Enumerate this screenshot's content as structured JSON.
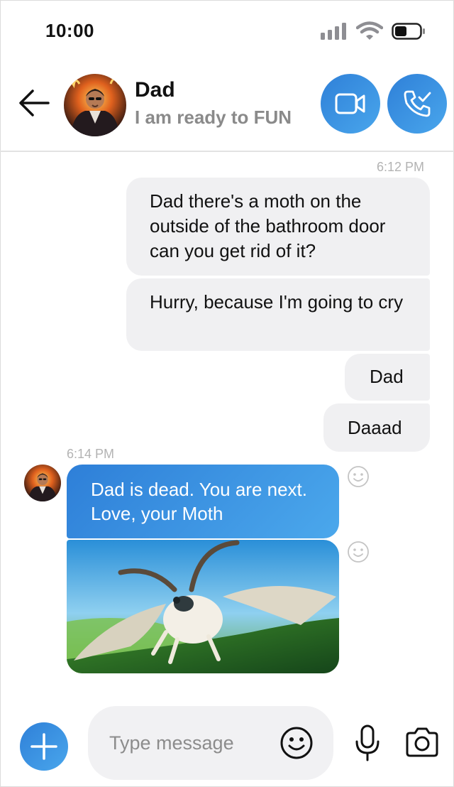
{
  "status_bar": {
    "time": "10:00"
  },
  "header": {
    "contact_name": "Dad",
    "contact_status": "I am ready to FUN"
  },
  "messages": {
    "timestamp_1": "6:12 PM",
    "outgoing": [
      "Dad there's a moth on the outside of the bathroom door can you get rid of it?",
      "Hurry, because I'm going to cry",
      "Dad",
      "Daaad"
    ],
    "timestamp_2": "6:14 PM",
    "incoming_text": "Dad is dead. You are next. Love, your Moth"
  },
  "composer": {
    "placeholder": "Type message"
  },
  "icons": {
    "back": "back-arrow-icon",
    "video": "video-camera-icon",
    "phone": "phone-call-icon",
    "reaction": "smiley-icon",
    "add": "plus-icon",
    "emoji": "smiley-icon",
    "mic": "microphone-icon",
    "camera": "camera-icon"
  },
  "colors": {
    "accent": "#2f80d8",
    "accent_light": "#49a6ec",
    "bubble_gray": "#f0f0f2",
    "timestamp": "#b3b3b3"
  }
}
